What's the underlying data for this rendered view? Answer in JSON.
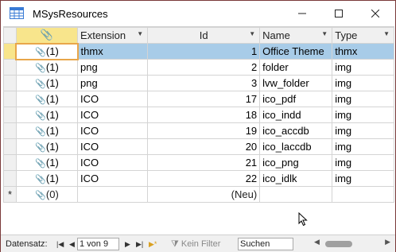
{
  "window": {
    "title": "MSysResources"
  },
  "columns": [
    {
      "label": "",
      "icon": "paperclip-icon"
    },
    {
      "label": "Extension"
    },
    {
      "label": "Id"
    },
    {
      "label": "Name"
    },
    {
      "label": "Type"
    }
  ],
  "rows": [
    {
      "att": "(1)",
      "ext": "thmx",
      "id": "1",
      "name": "Office Theme",
      "type": "thmx"
    },
    {
      "att": "(1)",
      "ext": "png",
      "id": "2",
      "name": "folder",
      "type": "img"
    },
    {
      "att": "(1)",
      "ext": "png",
      "id": "3",
      "name": "lvw_folder",
      "type": "img"
    },
    {
      "att": "(1)",
      "ext": "ICO",
      "id": "17",
      "name": "ico_pdf",
      "type": "img"
    },
    {
      "att": "(1)",
      "ext": "ICO",
      "id": "18",
      "name": "ico_indd",
      "type": "img"
    },
    {
      "att": "(1)",
      "ext": "ICO",
      "id": "19",
      "name": "ico_accdb",
      "type": "img"
    },
    {
      "att": "(1)",
      "ext": "ICO",
      "id": "20",
      "name": "ico_laccdb",
      "type": "img"
    },
    {
      "att": "(1)",
      "ext": "ICO",
      "id": "21",
      "name": "ico_png",
      "type": "img"
    },
    {
      "att": "(1)",
      "ext": "ICO",
      "id": "22",
      "name": "ico_idlk",
      "type": "img"
    }
  ],
  "new_row": {
    "marker": "*",
    "att": "(0)",
    "id": "(Neu)"
  },
  "statusbar": {
    "label": "Datensatz:",
    "record": "1 von 9",
    "filter": "Kein Filter",
    "search": "Suchen"
  }
}
